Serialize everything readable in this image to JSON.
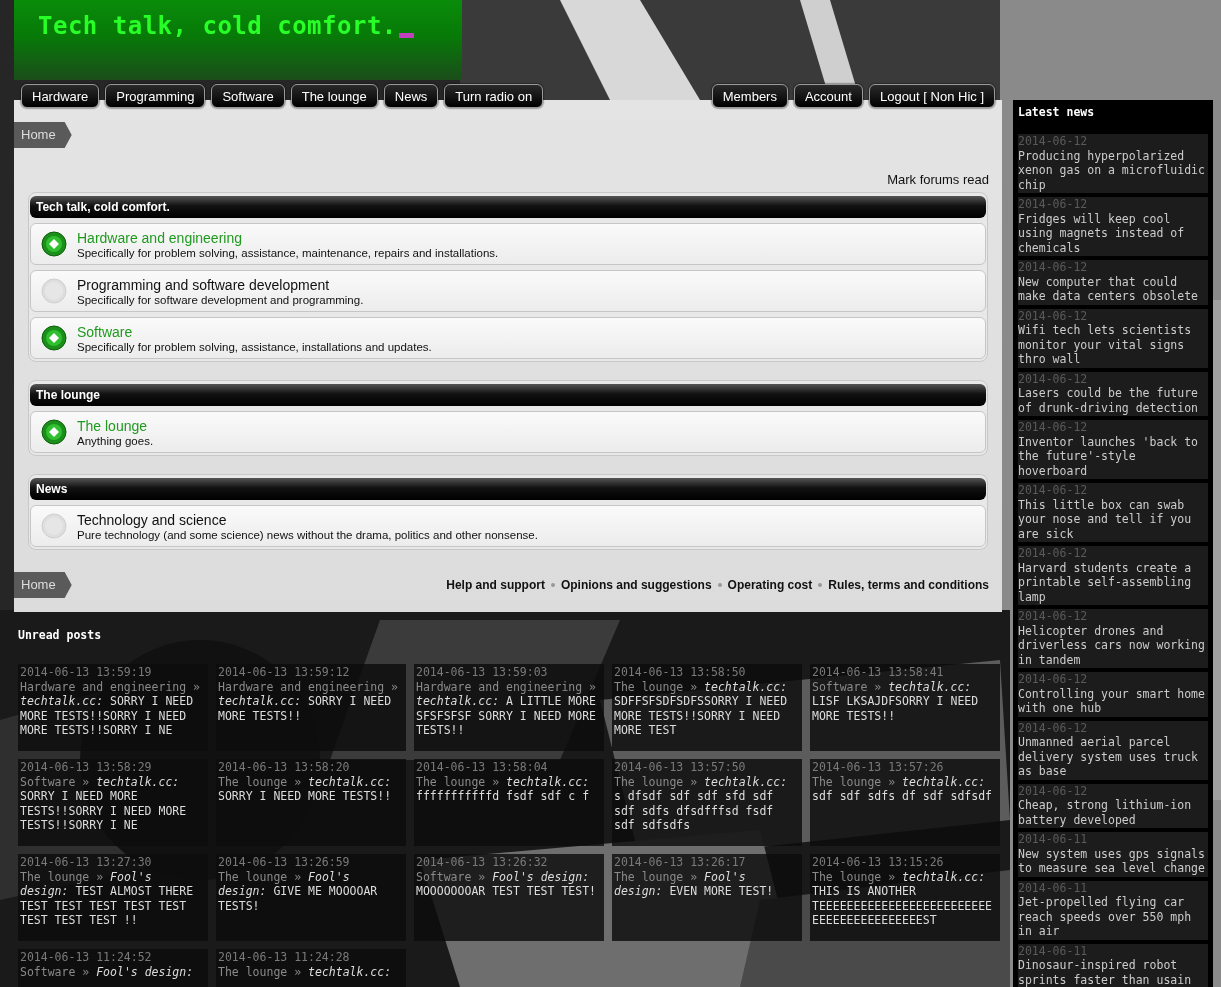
{
  "logo": {
    "title": "Tech talk, cold comfort."
  },
  "nav_left": [
    {
      "label": "Hardware"
    },
    {
      "label": "Programming"
    },
    {
      "label": "Software"
    },
    {
      "label": "The lounge"
    },
    {
      "label": "News"
    },
    {
      "label": "Turn radio on"
    }
  ],
  "nav_right": [
    {
      "label": "Members"
    },
    {
      "label": "Account"
    },
    {
      "label": "Logout [ Non Hic ]"
    }
  ],
  "breadcrumb_top": "Home",
  "mark_read": "Mark forums read",
  "categories": [
    {
      "title": "Tech talk, cold comfort.",
      "forums": [
        {
          "name": "Hardware and engineering",
          "description": "Specifically for problem solving, assistance, maintenance, repairs and installations.",
          "unread": true
        },
        {
          "name": "Programming and software development",
          "description": "Specifically for software development and programming.",
          "unread": false
        },
        {
          "name": "Software",
          "description": "Specifically for problem solving, assistance, installations and updates.",
          "unread": true
        }
      ]
    },
    {
      "title": "The lounge",
      "forums": [
        {
          "name": "The lounge",
          "description": "Anything goes.",
          "unread": true
        }
      ]
    },
    {
      "title": "News",
      "forums": [
        {
          "name": "Technology and science",
          "description": "Pure technology (and some science) news without the drama, politics and other nonsense.",
          "unread": false
        }
      ]
    }
  ],
  "breadcrumb_bottom": "Home",
  "footer_links": [
    "Help and support",
    "Opinions and suggestions",
    "Operating cost",
    "Rules, terms and conditions"
  ],
  "unread_posts": {
    "title": "Unread posts",
    "posts": [
      {
        "date": "2014-06-13 13:59:19",
        "forum": "Hardware and engineering »",
        "topic": "techtalk.cc:",
        "text": "SORRY I NEED MORE TESTS!!SORRY I NEED MORE TESTS!!SORRY I NE"
      },
      {
        "date": "2014-06-13 13:59:12",
        "forum": "Hardware and engineering »",
        "topic": "techtalk.cc:",
        "text": "SORRY I NEED MORE TESTS!!"
      },
      {
        "date": "2014-06-13 13:59:03",
        "forum": "Hardware and engineering »",
        "topic": "techtalk.cc:",
        "text": "A LITTLE MORE SFSFSFSF SORRY I NEED MORE TESTS!!"
      },
      {
        "date": "2014-06-13 13:58:50",
        "forum": "The lounge »",
        "topic": "techtalk.cc:",
        "text": "SDFFSFSDFSDFSSORRY I NEED MORE TESTS!!SORRY I NEED MORE TEST"
      },
      {
        "date": "2014-06-13 13:58:41",
        "forum": "Software »",
        "topic": "techtalk.cc:",
        "text": "LISF LKSAJDFSORRY I NEED MORE TESTS!!"
      },
      {
        "date": "2014-06-13 13:58:29",
        "forum": "Software »",
        "topic": "techtalk.cc:",
        "text": "SORRY I NEED MORE TESTS!!SORRY I NEED MORE TESTS!!SORRY I NE"
      },
      {
        "date": "2014-06-13 13:58:20",
        "forum": "The lounge »",
        "topic": "techtalk.cc:",
        "text": "SORRY I NEED MORE TESTS!!"
      },
      {
        "date": "2014-06-13 13:58:04",
        "forum": "The lounge »",
        "topic": "techtalk.cc:",
        "text": "fffffffffffd fsdf sdf c f"
      },
      {
        "date": "2014-06-13 13:57:50",
        "forum": "The lounge »",
        "topic": "techtalk.cc:",
        "text": "s dfsdf sdf sdf sfd sdf sdf sdfs dfsdfffsd fsdf sdf sdfsdfs"
      },
      {
        "date": "2014-06-13 13:57:26",
        "forum": "The lounge »",
        "topic": "techtalk.cc:",
        "text": "sdf sdf sdfs df sdf sdfsdf"
      },
      {
        "date": "2014-06-13 13:27:30",
        "forum": "The lounge »",
        "topic": "Fool's design:",
        "text": "TEST ALMOST THERE TEST TEST TEST TEST TEST TEST TEST TEST !!"
      },
      {
        "date": "2014-06-13 13:26:59",
        "forum": "The lounge »",
        "topic": "Fool's design:",
        "text": "GIVE ME MOOOOAR TESTS!"
      },
      {
        "date": "2014-06-13 13:26:32",
        "forum": "Software »",
        "topic": "Fool's design:",
        "text": "MOOOOOOOAR TEST TEST TEST!"
      },
      {
        "date": "2014-06-13 13:26:17",
        "forum": "The lounge »",
        "topic": "Fool's design:",
        "text": "EVEN MORE TEST!"
      },
      {
        "date": "2014-06-13 13:15:26",
        "forum": "The lounge »",
        "topic": "techtalk.cc:",
        "text": "THIS IS ANOTHER TEEEEEEEEEEEEEEEEEEEEEEEEEEEEEEEEEEEEEEEEEST"
      },
      {
        "date": "2014-06-13 11:24:52",
        "forum": "Software »",
        "topic": "Fool's design:"
      },
      {
        "date": "2014-06-13 11:24:28",
        "forum": "The lounge »",
        "topic": "techtalk.cc:"
      }
    ]
  },
  "latest_news": {
    "title": "Latest news",
    "items": [
      {
        "date": "2014-06-12",
        "title": "Producing hyperpolarized xenon gas on a microfluidic chip"
      },
      {
        "date": "2014-06-12",
        "title": "Fridges will keep cool using magnets instead of chemicals"
      },
      {
        "date": "2014-06-12",
        "title": "New computer that could make data centers obsolete"
      },
      {
        "date": "2014-06-12",
        "title": "Wifi tech lets scientists monitor your vital signs thro wall"
      },
      {
        "date": "2014-06-12",
        "title": "Lasers could be the future of drunk-driving detection"
      },
      {
        "date": "2014-06-12",
        "title": "Inventor launches 'back to the future'-style hoverboard"
      },
      {
        "date": "2014-06-12",
        "title": "This little box can swab your nose and tell if you are sick"
      },
      {
        "date": "2014-06-12",
        "title": "Harvard students create a printable self-assembling lamp"
      },
      {
        "date": "2014-06-12",
        "title": "Helicopter drones and driverless cars now working in tandem"
      },
      {
        "date": "2014-06-12",
        "title": "Controlling your smart home with one hub"
      },
      {
        "date": "2014-06-12",
        "title": "Unmanned aerial parcel delivery system uses truck as base"
      },
      {
        "date": "2014-06-12",
        "title": "Cheap, strong lithium-ion battery developed"
      },
      {
        "date": "2014-06-11",
        "title": "New system uses gps signals to measure sea level change"
      },
      {
        "date": "2014-06-11",
        "title": "Jet-propelled flying car reach speeds over 550 mph in air"
      },
      {
        "date": "2014-06-11",
        "title": "Dinosaur-inspired robot sprints faster than usain"
      }
    ]
  }
}
